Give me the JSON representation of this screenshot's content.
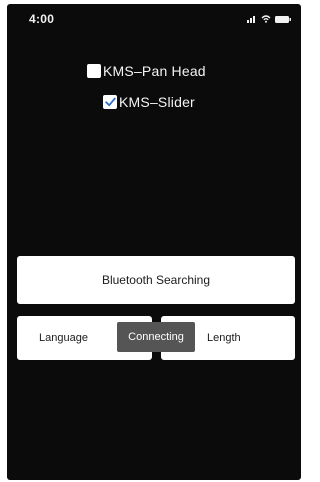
{
  "status_bar": {
    "time": "4:00",
    "icons": [
      "signal-icon",
      "wifi-icon",
      "battery-icon"
    ]
  },
  "devices": [
    {
      "label": "KMS–Pan Head",
      "checked": false
    },
    {
      "label": "KMS–Slider",
      "checked": true
    }
  ],
  "actions": {
    "bluetooth_label": "Bluetooth Searching",
    "language_label": "Language",
    "length_label": "Length"
  },
  "toast": {
    "text": "Connecting"
  },
  "colors": {
    "screen_background": "#0b0b0b",
    "button_background": "#ffffff",
    "toast_background": "#555555",
    "check_mark": "#2f6fd0"
  }
}
